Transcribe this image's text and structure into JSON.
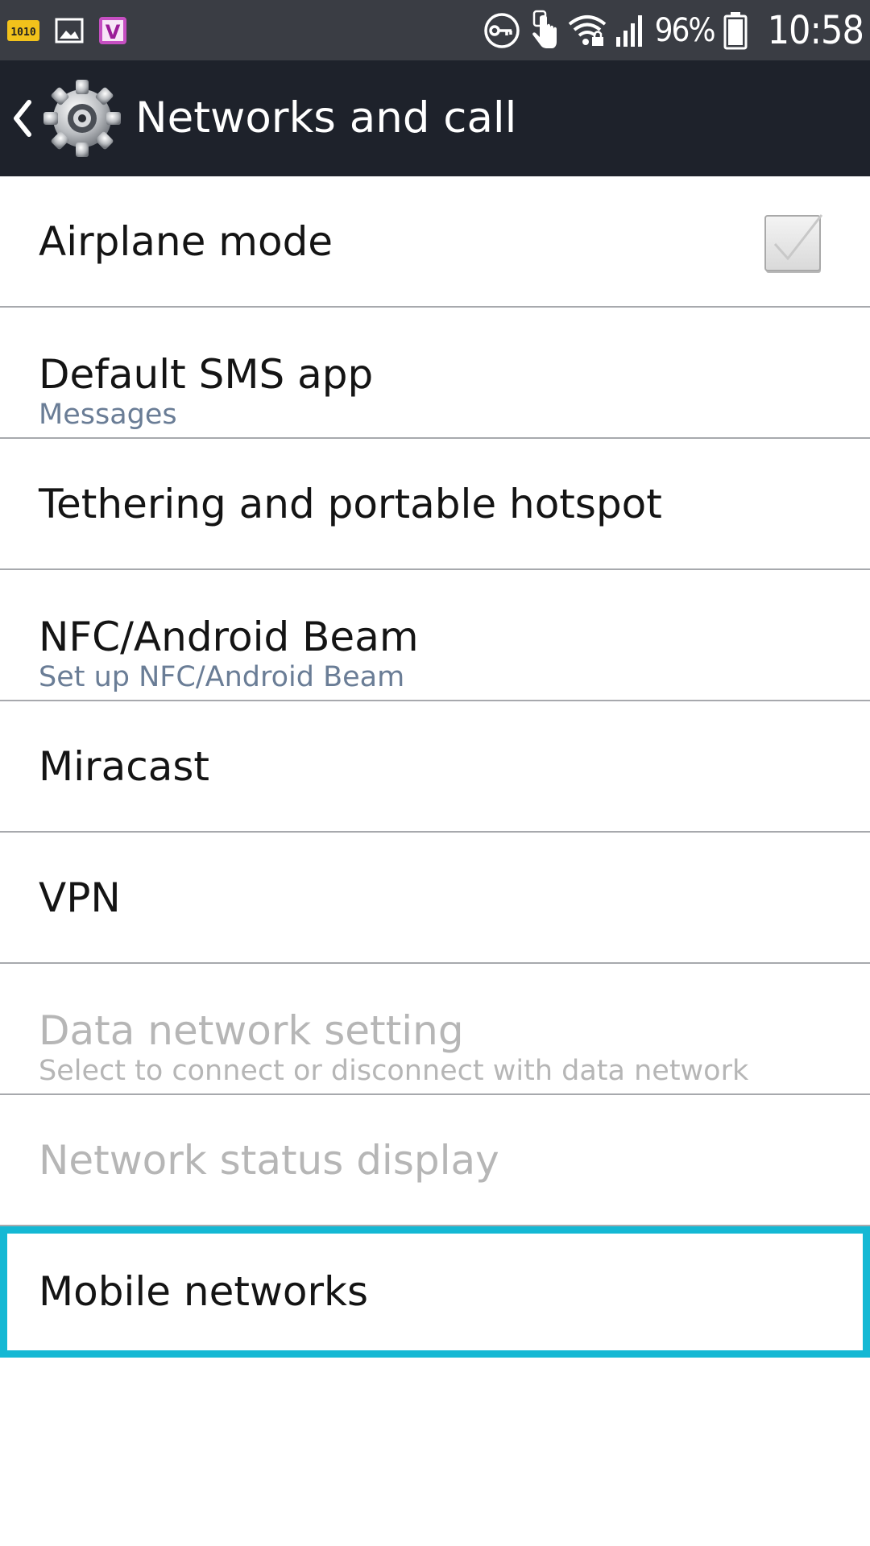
{
  "status_bar": {
    "left_icons": [
      "1010-app-icon",
      "image-icon",
      "v-app-icon"
    ],
    "battery_percent": "96%",
    "time": "10:58",
    "right_icons": [
      "vpn-key-icon",
      "touch-icon",
      "wifi-icon",
      "signal-icon",
      "battery-icon"
    ]
  },
  "action_bar": {
    "title": "Networks and call",
    "back_icon": "back-chevron-icon",
    "app_icon": "settings-gear-icon"
  },
  "settings": [
    {
      "title": "Airplane mode",
      "subtitle": null,
      "checkbox": true,
      "checked": false,
      "enabled": true
    },
    {
      "title": "Default SMS app",
      "subtitle": "Messages",
      "enabled": true
    },
    {
      "title": "Tethering and portable hotspot",
      "subtitle": null,
      "enabled": true
    },
    {
      "title": "NFC/Android Beam",
      "subtitle": "Set up NFC/Android Beam",
      "enabled": true
    },
    {
      "title": "Miracast",
      "subtitle": null,
      "enabled": true
    },
    {
      "title": "VPN",
      "subtitle": null,
      "enabled": true
    },
    {
      "title": "Data network setting",
      "subtitle": "Select to connect or disconnect with data network",
      "enabled": false
    },
    {
      "title": "Network status display",
      "subtitle": null,
      "enabled": false
    },
    {
      "title": "Mobile networks",
      "subtitle": null,
      "enabled": true,
      "highlighted": true
    }
  ],
  "colors": {
    "status_bar_bg": "#3a3d44",
    "action_bar_bg": "#1e222b",
    "highlight_border": "#14b8d4",
    "subtitle_text": "#6a7d96",
    "disabled_text": "#b6b6b6"
  }
}
